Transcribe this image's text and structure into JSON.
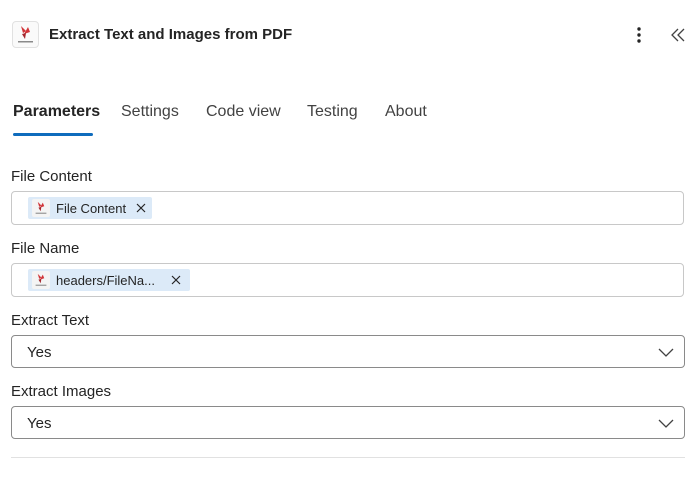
{
  "header": {
    "title": "Extract Text and Images from PDF",
    "logo_icon": "pdf4me-logo-icon",
    "more_icon": "more-vertical-icon",
    "collapse_icon": "double-chevron-left-icon"
  },
  "tabs": [
    {
      "label": "Parameters",
      "active": true
    },
    {
      "label": "Settings",
      "active": false
    },
    {
      "label": "Code view",
      "active": false
    },
    {
      "label": "Testing",
      "active": false
    },
    {
      "label": "About",
      "active": false
    }
  ],
  "fields": {
    "file_content": {
      "label": "File Content",
      "token": "File Content"
    },
    "file_name": {
      "label": "File Name",
      "token": "headers/FileNa..."
    },
    "extract_text": {
      "label": "Extract Text",
      "value": "Yes"
    },
    "extract_images": {
      "label": "Extract Images",
      "value": "Yes"
    }
  },
  "colors": {
    "accent": "#0f6cbd",
    "token_bg": "#dceaf8",
    "logo_red": "#d13438"
  }
}
